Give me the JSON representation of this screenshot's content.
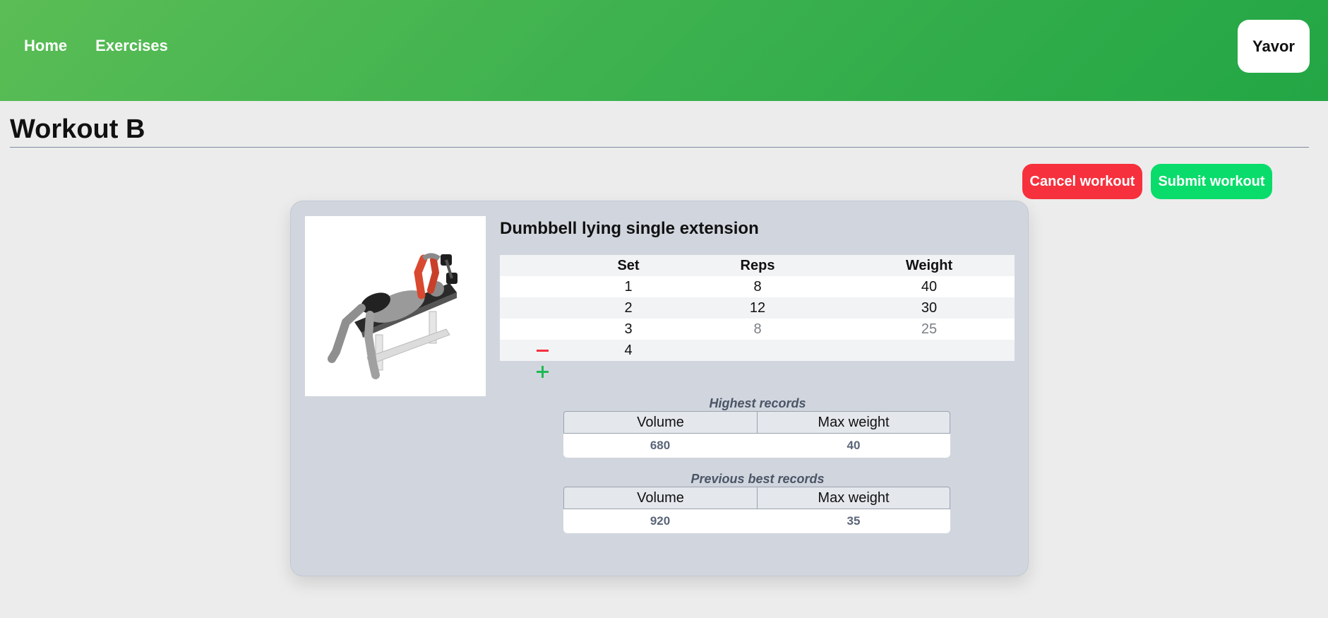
{
  "nav": {
    "home": "Home",
    "exercises": "Exercises",
    "user": "Yavor"
  },
  "page": {
    "title": "Workout B"
  },
  "actions": {
    "cancel": "Cancel workout",
    "submit": "Submit workout"
  },
  "exercise": {
    "name": "Dumbbell lying single extension",
    "image_icon": "dumbbell-lying-extension-illustration",
    "columns": {
      "set": "Set",
      "reps": "Reps",
      "weight": "Weight"
    },
    "sets": [
      {
        "set": "1",
        "reps": "8",
        "weight": "40"
      },
      {
        "set": "2",
        "reps": "12",
        "weight": "30"
      },
      {
        "set": "3",
        "reps": "8",
        "weight": "25"
      },
      {
        "set": "4",
        "reps": "",
        "weight": ""
      }
    ]
  },
  "highest_records": {
    "caption": "Highest records",
    "volume_label": "Volume",
    "max_weight_label": "Max weight",
    "volume": "680",
    "max_weight": "40"
  },
  "previous_best_records": {
    "caption": "Previous best records",
    "volume_label": "Volume",
    "max_weight_label": "Max weight",
    "volume": "920",
    "max_weight": "35"
  },
  "colors": {
    "header_start": "#5bbd55",
    "header_end": "#23a645",
    "cancel": "#f6303d",
    "submit": "#09dc6b",
    "add": "#1fb954",
    "remove": "#f6303d"
  }
}
